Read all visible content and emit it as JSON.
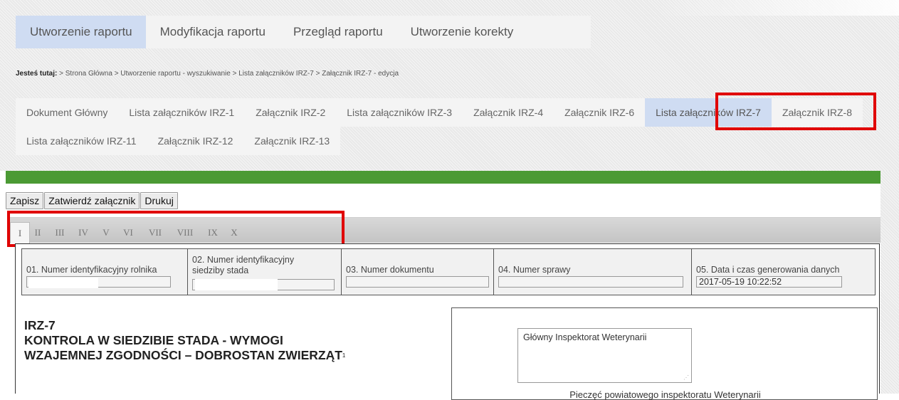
{
  "main_tabs": [
    {
      "label": "Utworzenie raportu"
    },
    {
      "label": "Modyfikacja raportu"
    },
    {
      "label": "Przegląd raportu"
    },
    {
      "label": "Utworzenie korekty"
    }
  ],
  "breadcrumb": {
    "label": "Jesteś tutaj:",
    "items": [
      "> Strona Główna",
      "> Utworzenie raportu - wyszukiwanie",
      "> Lista załączników IRZ-7",
      "> Załącznik IRZ-7 - edycja"
    ]
  },
  "sub_tabs": [
    {
      "label": "Dokument Główny"
    },
    {
      "label": "Lista załączników IRZ-1"
    },
    {
      "label": "Załącznik IRZ-2"
    },
    {
      "label": "Lista załączników IRZ-3"
    },
    {
      "label": "Załącznik IRZ-4"
    },
    {
      "label": "Załącznik IRZ-6"
    },
    {
      "label": "Lista załączników IRZ-7"
    },
    {
      "label": "Załącznik IRZ-8"
    },
    {
      "label": "Lista załączników IRZ-11"
    },
    {
      "label": "Załącznik IRZ-12"
    },
    {
      "label": "Załącznik IRZ-13"
    }
  ],
  "active_sub_tab": "Lista załączników IRZ-7",
  "toolbar": {
    "save": "Zapisz",
    "approve": "Zatwierdź załącznik",
    "print": "Drukuj"
  },
  "roman_tabs": [
    "I",
    "II",
    "III",
    "IV",
    "V",
    "VI",
    "VII",
    "VIII",
    "IX",
    "X"
  ],
  "active_roman_tab": "I",
  "fields": [
    {
      "label": "01. Numer identyfikacyjny rolnika",
      "value": ""
    },
    {
      "label": "02. Numer identyfikacyjny siedziby stada",
      "value": ""
    },
    {
      "label": "03. Numer dokumentu",
      "value": ""
    },
    {
      "label": "04. Numer sprawy",
      "value": ""
    },
    {
      "label": "05. Data i czas generowania danych",
      "value": "2017-05-19 10:22:52"
    }
  ],
  "title": {
    "code": "IRZ-7",
    "line1": "KONTROLA W SIEDZIBIE STADA - WYMOGI",
    "line2": "WZAJEMNEJ ZGODNOŚCI – DOBROSTAN ZWIERZĄT",
    "footnote": "1"
  },
  "stamp": {
    "text": "Główny Inspektorat Weterynarii",
    "caption": "Pieczęć powiatowego inspektoratu Weterynarii"
  },
  "colors": {
    "active_tab": "#cfdcf2",
    "highlight": "#e00000",
    "green_bar": "#4b9a34"
  }
}
